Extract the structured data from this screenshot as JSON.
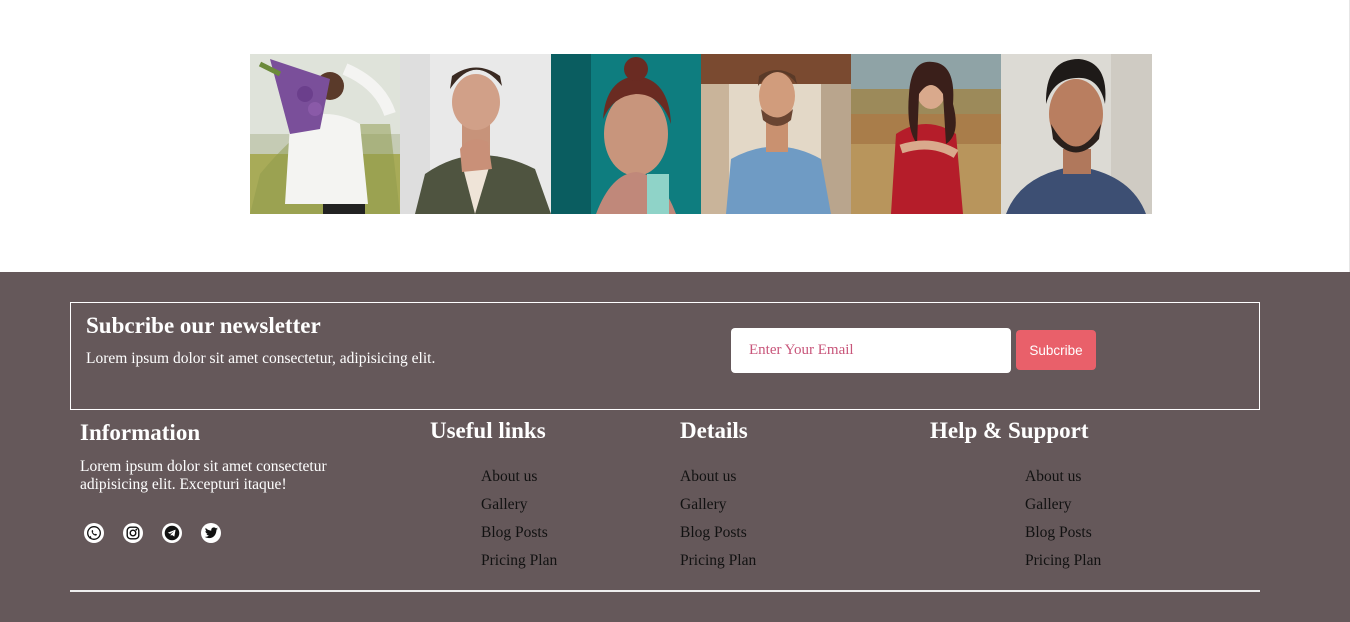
{
  "gallery": {
    "photos": [
      {
        "name": "woman-holding-lavender-photo"
      },
      {
        "name": "man-in-olive-jacket-photo"
      },
      {
        "name": "woman-teal-background-photo"
      },
      {
        "name": "man-in-blue-polo-photo"
      },
      {
        "name": "woman-in-red-dress-photo"
      },
      {
        "name": "bearded-man-portrait-photo"
      }
    ]
  },
  "newsletter": {
    "title": "Subcribe our newsletter",
    "text": "Lorem ipsum dolor sit amet consectetur, adipisicing elit.",
    "email_placeholder": "Enter Your Email",
    "email_value": "",
    "button_label": "Subcribe"
  },
  "information": {
    "title": "Information",
    "text": "Lorem ipsum dolor sit amet consectetur adipisicing elit. Excepturi itaque!",
    "socials": [
      "whatsapp-icon",
      "instagram-icon",
      "telegram-icon",
      "twitter-icon"
    ]
  },
  "useful_links": {
    "title": "Useful links",
    "items": [
      "About us",
      "Gallery",
      "Blog Posts",
      "Pricing Plan"
    ]
  },
  "details": {
    "title": "Details",
    "items": [
      "About us",
      "Gallery",
      "Blog Posts",
      "Pricing Plan"
    ]
  },
  "help_support": {
    "title": "Help & Support",
    "items": [
      "About us",
      "Gallery",
      "Blog Posts",
      "Pricing Plan"
    ]
  },
  "colors": {
    "footer_bg": "#65585a",
    "accent": "#e9606a",
    "placeholder": "#c8557a"
  }
}
